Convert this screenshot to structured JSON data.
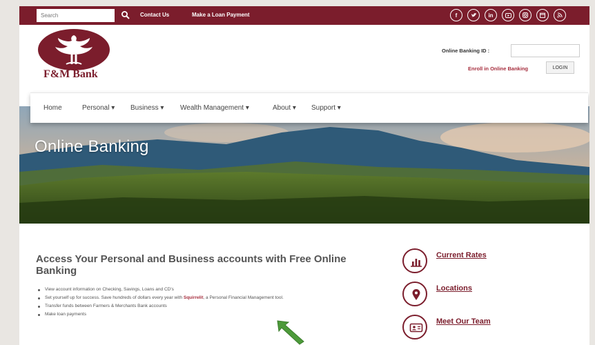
{
  "topbar": {
    "search_placeholder": "Search",
    "links": [
      "Contact Us",
      "Make a Loan Payment"
    ],
    "social_icons": [
      "facebook-icon",
      "twitter-icon",
      "linkedin-icon",
      "youtube-icon",
      "instagram-icon",
      "calendar-icon",
      "rss-icon"
    ],
    "color": "#7b1d2c"
  },
  "header": {
    "logo_text": "F&M Bank",
    "online_banking_label": "Online Banking ID :",
    "enroll_label": "Enroll in Online Banking",
    "login_label": "LOGIN"
  },
  "nav": {
    "items": [
      "Home",
      "Personal",
      "Business",
      "Wealth Management",
      "About",
      "Support"
    ]
  },
  "hero": {
    "title": "Online Banking"
  },
  "content": {
    "headline": "Access Your Personal and Business accounts with Free Online Banking",
    "bullets": [
      {
        "text": "View account information on Checking, Savings, Loans and CD's"
      },
      {
        "text_before": "Set yourself up for success. Save hundreds of dollars every year with ",
        "link": "Squirrelit",
        "text_after": ", a Personal Financial Management tool."
      },
      {
        "text": "Transfer funds between Farmers & Merchants Bank accounts"
      },
      {
        "text": "Make loan payments"
      }
    ]
  },
  "sidebar": {
    "links": [
      {
        "label": "Current Rates",
        "icon": "chart-icon"
      },
      {
        "label": "Locations",
        "icon": "map-pin-icon"
      },
      {
        "label": "Meet Our Team",
        "icon": "id-card-icon"
      }
    ]
  },
  "colors": {
    "brand": "#7b1d2c",
    "link": "#a62e3e",
    "text": "#555555"
  }
}
